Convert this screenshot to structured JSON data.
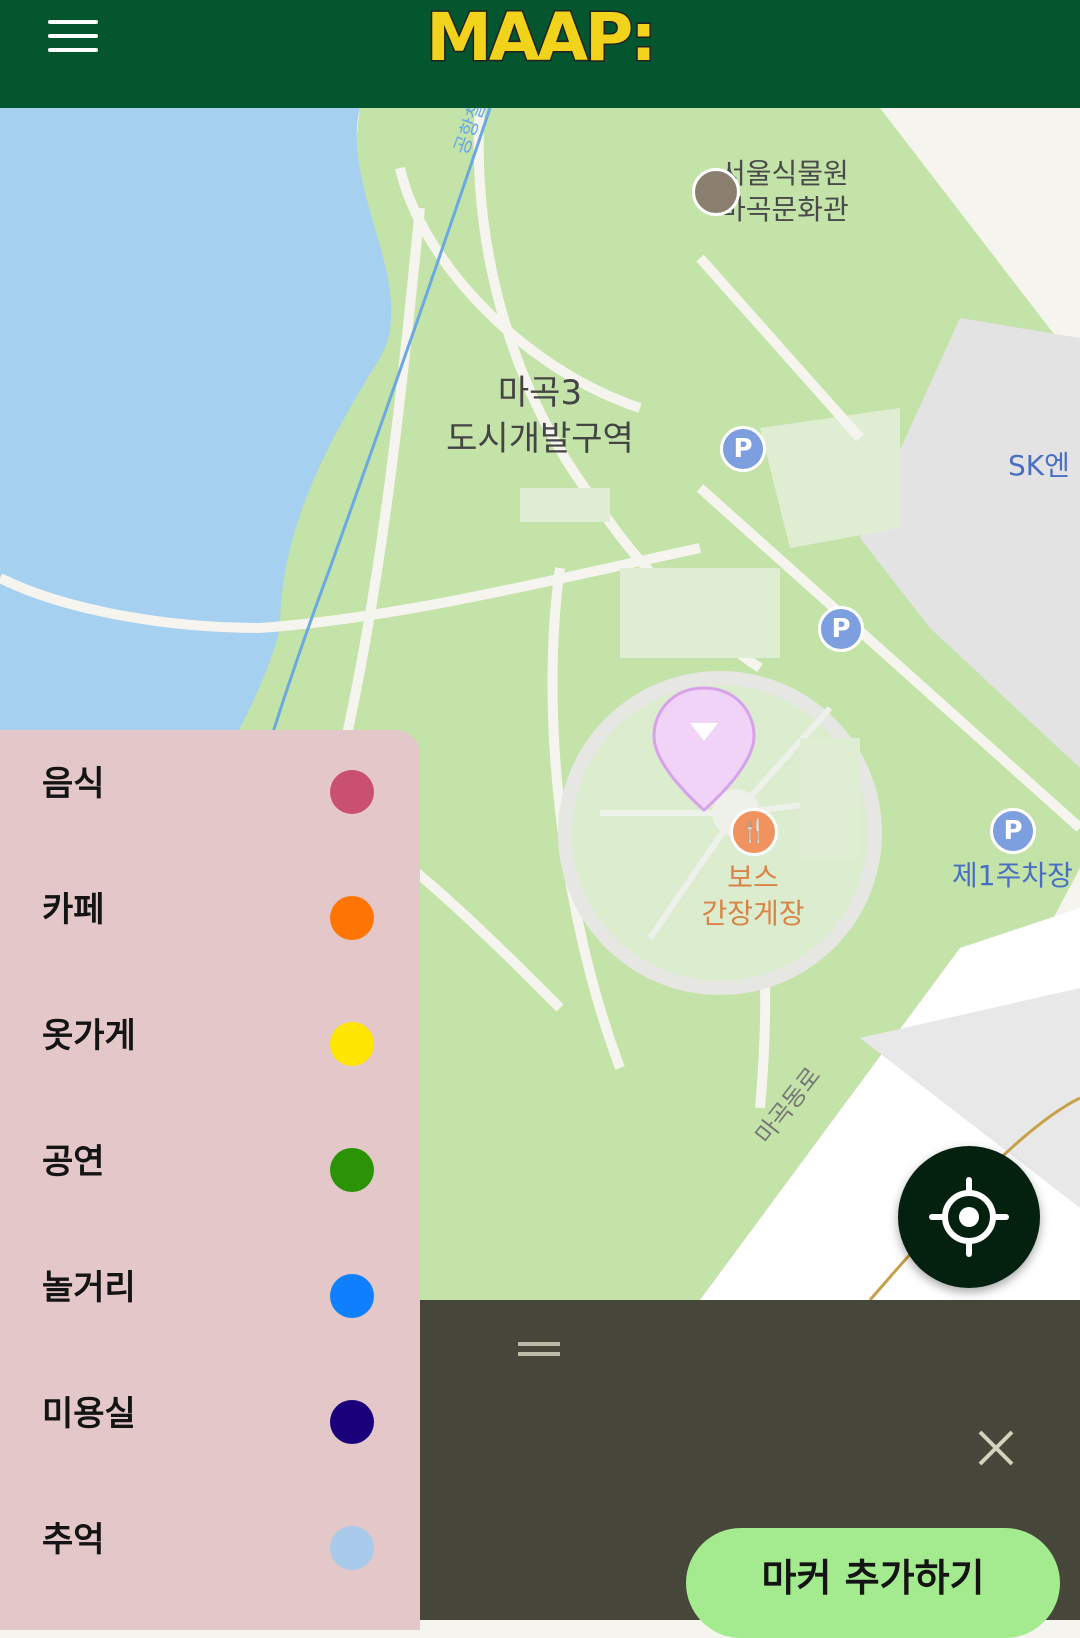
{
  "header": {
    "title": "MAAP:",
    "menu_icon": "hamburger-menu-icon",
    "background": "#03562d",
    "logo_color": "#f2d31b"
  },
  "map": {
    "labels": {
      "poi_museum": "서울식물원\n마곡문화관",
      "district": "마곡3\n도시개발구역",
      "building_sk": "SK엔",
      "parking_1": "제1주차장",
      "restaurant": "보스\n간장게장",
      "road": "마곡동로",
      "river_path": "공항철"
    },
    "parking_symbol": "P",
    "selected_pin_color": "#f0d3f6"
  },
  "categories": [
    {
      "label": "음식",
      "color": "#c9506e"
    },
    {
      "label": "카페",
      "color": "#ff7504"
    },
    {
      "label": "옷가게",
      "color": "#ffe600"
    },
    {
      "label": "공연",
      "color": "#2a9406"
    },
    {
      "label": "놀거리",
      "color": "#0f7ffe"
    },
    {
      "label": "미용실",
      "color": "#1a007b"
    },
    {
      "label": "추억",
      "color": "#a8cbeb"
    }
  ],
  "controls": {
    "locate_icon": "crosshair-location-icon",
    "close_icon": "close-icon",
    "add_marker_label": "마커 추가하기"
  }
}
